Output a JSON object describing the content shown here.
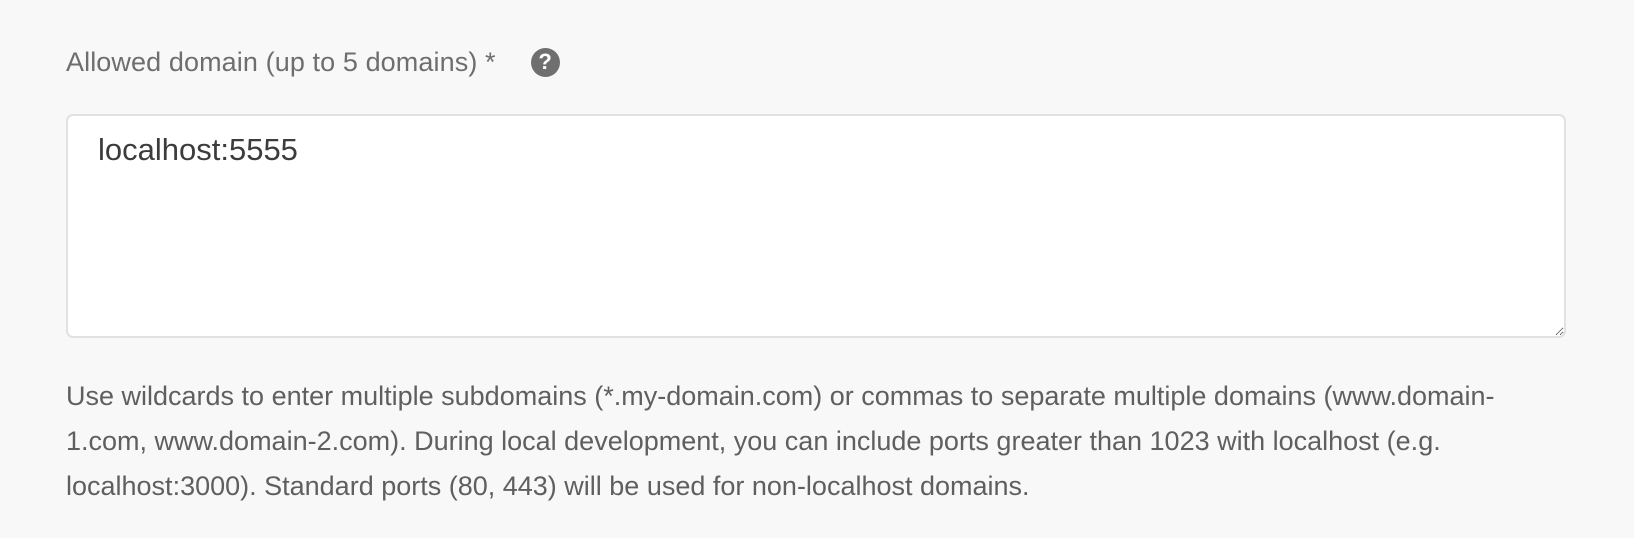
{
  "allowed_domain": {
    "label": "Allowed domain (up to 5 domains) *",
    "help_icon": "question-circle-icon",
    "value": "localhost:5555",
    "hint": "Use wildcards to enter multiple subdomains (*.my-domain.com) or commas to separate multiple domains (www.domain-1.com, www.domain-2.com). During local development, you can include ports greater than 1023 with localhost (e.g. localhost:3000). Standard ports (80, 443) will be used for non-localhost domains."
  }
}
